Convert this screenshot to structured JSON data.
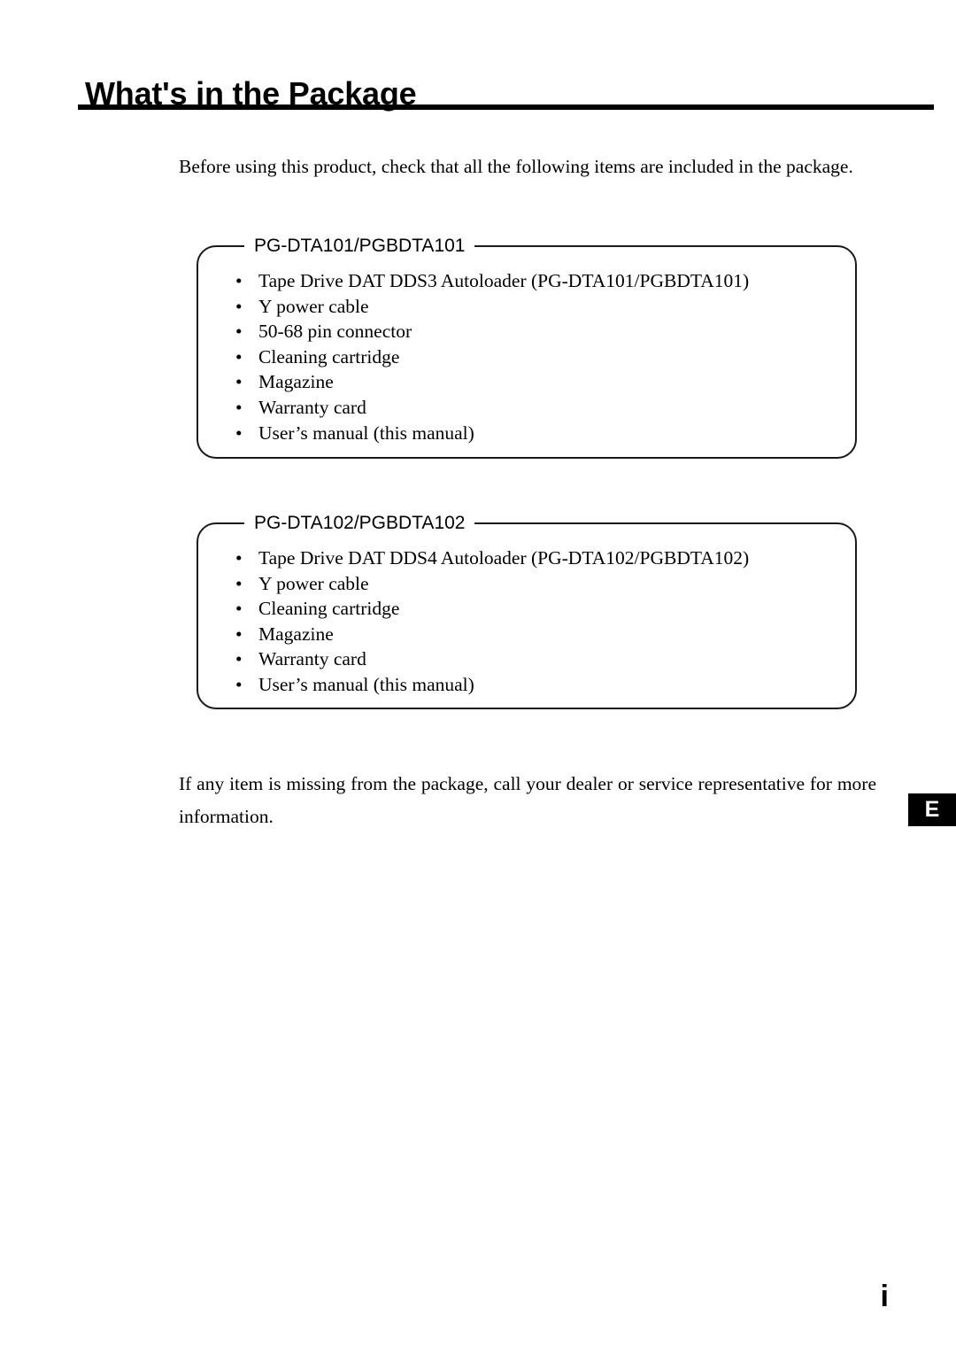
{
  "document": {
    "title": "What's in the Package",
    "intro_paragraph": "Before using this product, check that all the following items are included in the package.",
    "outro_paragraph": "If any item is missing from the package, call your dealer or service representative for more information.",
    "language_tab": "E",
    "page_number": "i"
  },
  "groups": [
    {
      "legend": "PG-DTA101/PGBDTA101",
      "bullet_glyph": "•",
      "items": [
        "Tape Drive DAT DDS3 Autoloader (PG-DTA101/PGBDTA101)",
        "Y power cable",
        "50-68 pin connector",
        "Cleaning cartridge",
        "Magazine",
        "Warranty card",
        "User’s manual (this manual)"
      ]
    },
    {
      "legend": "PG-DTA102/PGBDTA102",
      "bullet_glyph": "•",
      "items": [
        "Tape Drive DAT DDS4 Autoloader (PG-DTA102/PGBDTA102)",
        "Y power cable",
        "Cleaning cartridge",
        "Magazine",
        "Warranty card",
        "User’s manual (this manual)"
      ]
    }
  ]
}
